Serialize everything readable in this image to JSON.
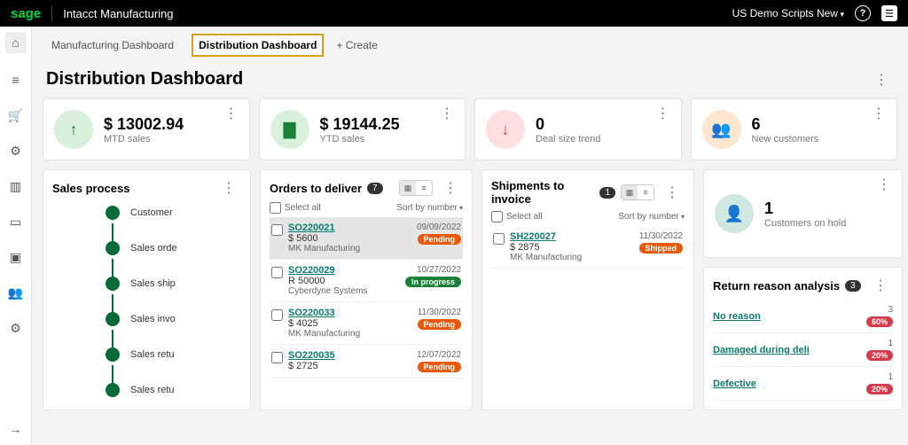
{
  "topbar": {
    "logo": "sage",
    "app_title": "Intacct Manufacturing",
    "context": "US Demo Scripts New"
  },
  "tabs": [
    {
      "label": "Manufacturing Dashboard",
      "active": false
    },
    {
      "label": "Distribution Dashboard",
      "active": true
    }
  ],
  "create_label": "+ Create",
  "page_title": "Distribution Dashboard",
  "kpis": [
    {
      "value": "$ 13002.94",
      "label": "MTD sales",
      "icon": "up-arrow"
    },
    {
      "value": "$ 19144.25",
      "label": "YTD sales",
      "icon": "bars"
    },
    {
      "value": "0",
      "label": "Deal size trend",
      "icon": "down-arrow"
    },
    {
      "value": "6",
      "label": "New customers",
      "icon": "people"
    }
  ],
  "sales_process": {
    "title": "Sales process",
    "steps": [
      "Customer",
      "Sales orde",
      "Sales ship",
      "Sales invo",
      "Sales retu",
      "Sales retu"
    ]
  },
  "orders": {
    "title": "Orders to deliver",
    "count": "7",
    "select_all": "Select all",
    "sort": "Sort by number",
    "items": [
      {
        "id": "SO220021",
        "amount": "$ 5600",
        "vendor": "MK Manufacturing",
        "date": "09/09/2022",
        "status": "Pending"
      },
      {
        "id": "SO220029",
        "amount": "R 50000",
        "vendor": "Cyberdyne Systems",
        "date": "10/27/2022",
        "status": "In progress"
      },
      {
        "id": "SO220033",
        "amount": "$ 4025",
        "vendor": "MK Manufacturing",
        "date": "11/30/2022",
        "status": "Pending"
      },
      {
        "id": "SO220035",
        "amount": "$ 2725",
        "vendor": "",
        "date": "12/07/2022",
        "status": "Pending"
      }
    ]
  },
  "shipments": {
    "title": "Shipments to invoice",
    "count": "1",
    "select_all": "Select all",
    "sort": "Sort by number",
    "items": [
      {
        "id": "SH220027",
        "amount": "$ 2875",
        "vendor": "MK Manufacturing",
        "date": "11/30/2022",
        "status": "Shipped"
      }
    ]
  },
  "hold": {
    "value": "1",
    "label": "Customers on hold"
  },
  "returns": {
    "title": "Return reason analysis",
    "count": "3",
    "items": [
      {
        "reason": "No reason",
        "n": "3",
        "pct": "60%"
      },
      {
        "reason": "Damaged during deli",
        "n": "1",
        "pct": "20%"
      },
      {
        "reason": "Defective",
        "n": "1",
        "pct": "20%"
      }
    ]
  }
}
